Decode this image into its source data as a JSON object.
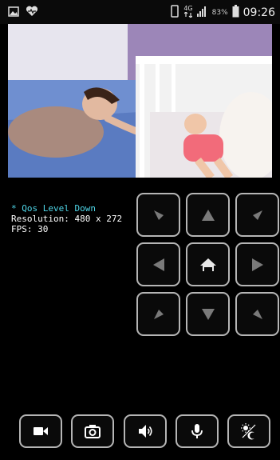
{
  "status_bar": {
    "network_label": "4G",
    "battery_percent": "83%",
    "time": "09:26"
  },
  "stream_info": {
    "qos": "* Qos Level Down",
    "resolution": "Resolution: 480 x 272",
    "fps": "FPS: 30"
  },
  "camera_feed": {
    "description_icon": "live-video-feed"
  },
  "ptz_pad": {
    "buttons": [
      "up-left",
      "up",
      "up-right",
      "left",
      "home",
      "right",
      "down-left",
      "down",
      "down-right"
    ]
  },
  "toolbar": {
    "buttons": [
      "video-record",
      "snapshot",
      "speaker",
      "microphone",
      "day-night"
    ]
  },
  "colors": {
    "accent": "#4fd6e8",
    "border": "#b5b5b5",
    "background": "#000000"
  }
}
